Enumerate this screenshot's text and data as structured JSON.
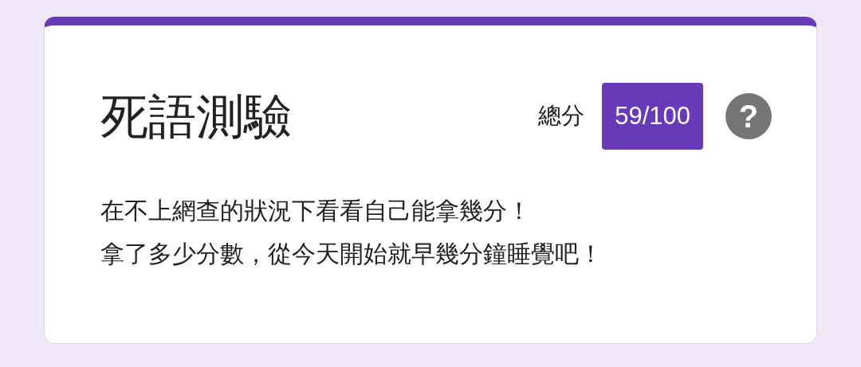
{
  "form": {
    "title": "死語測驗",
    "score_label": "總分",
    "score": "59/100",
    "help": "?",
    "description": [
      "在不上網查的狀況下看看自己能拿幾分！",
      "拿了多少分數，從今天開始就早幾分鐘睡覺吧！"
    ]
  }
}
